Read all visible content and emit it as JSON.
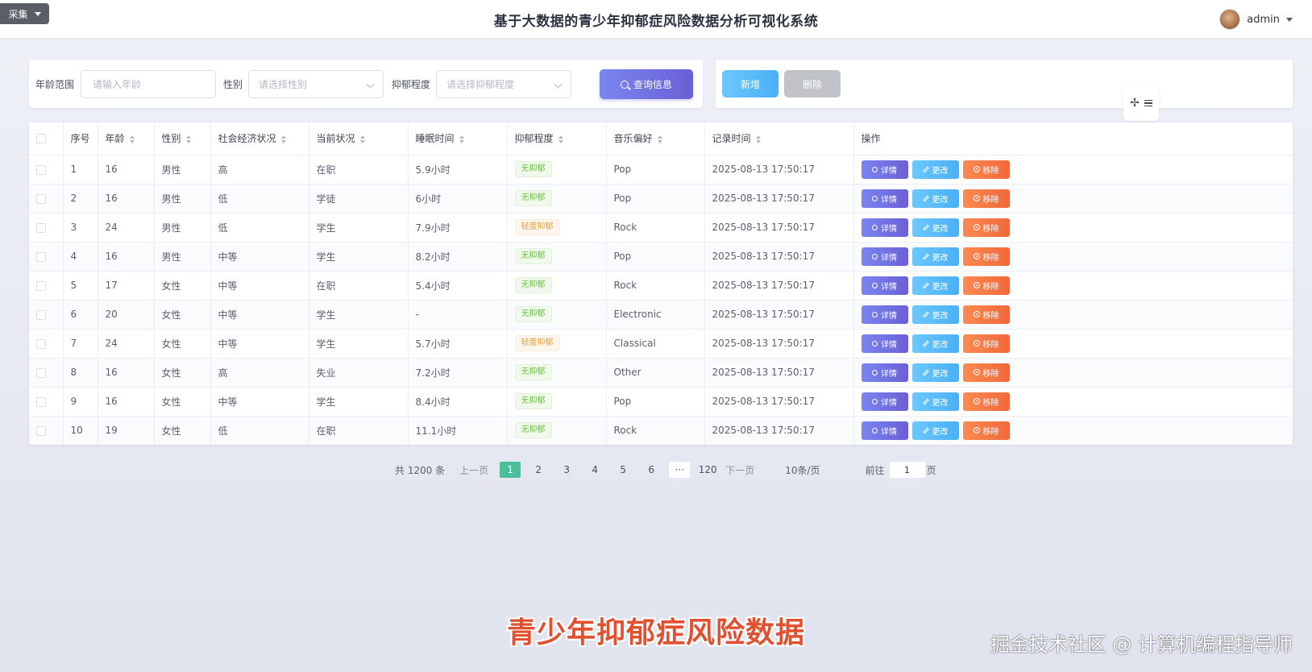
{
  "topbar": {
    "collect_label": "采集",
    "title": "基于大数据的青少年抑郁症风险数据分析可视化系统",
    "user_name": "admin"
  },
  "search": {
    "age_label": "年龄范围",
    "age_placeholder": "请输入年龄",
    "gender_label": "性别",
    "gender_placeholder": "请选择性别",
    "depression_label": "抑郁程度",
    "depression_placeholder": "请选择抑郁程度",
    "query_label": "查询信息"
  },
  "actions": {
    "add_label": "新增",
    "delete_label": "删除"
  },
  "table": {
    "headers": [
      "序号",
      "年龄",
      "性别",
      "社会经济状况",
      "当前状况",
      "睡眠时间",
      "抑郁程度",
      "音乐偏好",
      "记录时间",
      "操作"
    ],
    "op_labels": {
      "detail": "详情",
      "edit": "更改",
      "remove": "移除"
    },
    "rows": [
      {
        "id": "1",
        "age": "16",
        "gender": "男性",
        "ses": "高",
        "status": "在职",
        "sleep": "5.9小时",
        "level": "无抑郁",
        "music": "Pop",
        "time": "2025-08-13 17:50:17"
      },
      {
        "id": "2",
        "age": "16",
        "gender": "男性",
        "ses": "低",
        "status": "学徒",
        "sleep": "6小时",
        "level": "无抑郁",
        "music": "Pop",
        "time": "2025-08-13 17:50:17"
      },
      {
        "id": "3",
        "age": "24",
        "gender": "男性",
        "ses": "低",
        "status": "学生",
        "sleep": "7.9小时",
        "level": "轻度抑郁",
        "music": "Rock",
        "time": "2025-08-13 17:50:17"
      },
      {
        "id": "4",
        "age": "16",
        "gender": "男性",
        "ses": "中等",
        "status": "学生",
        "sleep": "8.2小时",
        "level": "无抑郁",
        "music": "Pop",
        "time": "2025-08-13 17:50:17"
      },
      {
        "id": "5",
        "age": "17",
        "gender": "女性",
        "ses": "中等",
        "status": "在职",
        "sleep": "5.4小时",
        "level": "无抑郁",
        "music": "Rock",
        "time": "2025-08-13 17:50:17"
      },
      {
        "id": "6",
        "age": "20",
        "gender": "女性",
        "ses": "中等",
        "status": "学生",
        "sleep": "-",
        "level": "无抑郁",
        "music": "Electronic",
        "time": "2025-08-13 17:50:17"
      },
      {
        "id": "7",
        "age": "24",
        "gender": "女性",
        "ses": "中等",
        "status": "学生",
        "sleep": "5.7小时",
        "level": "轻度抑郁",
        "music": "Classical",
        "time": "2025-08-13 17:50:17"
      },
      {
        "id": "8",
        "age": "16",
        "gender": "女性",
        "ses": "高",
        "status": "失业",
        "sleep": "7.2小时",
        "level": "无抑郁",
        "music": "Other",
        "time": "2025-08-13 17:50:17"
      },
      {
        "id": "9",
        "age": "16",
        "gender": "女性",
        "ses": "中等",
        "status": "学生",
        "sleep": "8.4小时",
        "level": "无抑郁",
        "music": "Pop",
        "time": "2025-08-13 17:50:17"
      },
      {
        "id": "10",
        "age": "19",
        "gender": "女性",
        "ses": "低",
        "status": "在职",
        "sleep": "11.1小时",
        "level": "无抑郁",
        "music": "Rock",
        "time": "2025-08-13 17:50:17"
      }
    ]
  },
  "pagination": {
    "total": "共 1200 条",
    "prev": "上一页",
    "pages": [
      "1",
      "2",
      "3",
      "4",
      "5",
      "6"
    ],
    "more": "···",
    "last": "120",
    "next": "下一页",
    "page_size": "10条/页",
    "goto_prefix": "前往",
    "goto_value": "1",
    "goto_suffix": "页"
  },
  "overlay": {
    "subtitle": "青少年抑郁症风险数据",
    "watermark": "掘金技术社区 @ 计算机编程指导师"
  },
  "colors": {
    "accent": "#6a5fd6",
    "info": "#49b0f5",
    "danger": "#f2683a",
    "page_active": "#4cbf9a"
  }
}
